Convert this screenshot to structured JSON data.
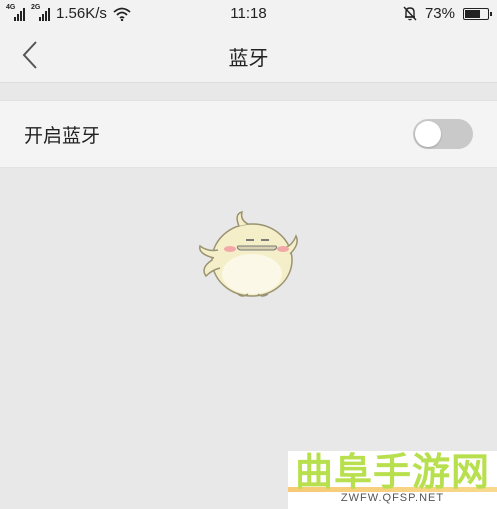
{
  "status_bar": {
    "network_1": "4G",
    "network_2": "2G",
    "speed": "1.56K/s",
    "time": "11:18",
    "battery_percent": "73%",
    "battery_level": 0.73
  },
  "nav": {
    "title": "蓝牙",
    "back_icon": "chevron-left-icon"
  },
  "settings": {
    "bluetooth_label": "开启蓝牙",
    "bluetooth_on": false
  },
  "illustration": {
    "icon": "bird-mascot"
  },
  "watermark": {
    "text": "曲阜手游网",
    "url": "ZWFW.QFSP.NET"
  },
  "colors": {
    "background": "#e8e8e8",
    "toggle_off": "#c9c9c9",
    "watermark_green": "#b8e04e"
  }
}
